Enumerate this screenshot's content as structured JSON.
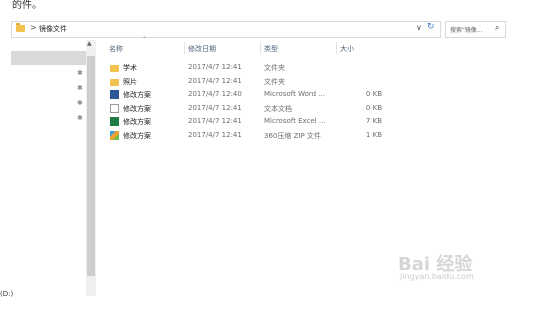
{
  "top_text": "的件。",
  "address": {
    "path": "镜像文件",
    "chevron": ">",
    "dropdown": "∨",
    "refresh": "↻"
  },
  "search": {
    "placeholder": "搜索\"镜像...",
    "icon": "⌕"
  },
  "columns": {
    "name": "名称",
    "date": "修改日期",
    "type": "类型",
    "size": "大小"
  },
  "files": [
    {
      "name": "学术",
      "date": "2017/4/7 12:41",
      "type": "文件夹",
      "size": "",
      "icon": "folder"
    },
    {
      "name": "照片",
      "date": "2017/4/7 12:41",
      "type": "文件夹",
      "size": "",
      "icon": "folder"
    },
    {
      "name": "修改方案",
      "date": "2017/4/7 12:40",
      "type": "Microsoft Word ...",
      "size": "0 KB",
      "icon": "word"
    },
    {
      "name": "修改方案",
      "date": "2017/4/7 12:41",
      "type": "文本文档",
      "size": "0 KB",
      "icon": "text"
    },
    {
      "name": "修改方案",
      "date": "2017/4/7 12:41",
      "type": "Microsoft Excel ...",
      "size": "7 KB",
      "icon": "excel"
    },
    {
      "name": "修改方案",
      "date": "2017/4/7 12:41",
      "type": "360压缩 ZIP 文件",
      "size": "1 KB",
      "icon": "zip"
    }
  ],
  "nav": {
    "bottom_label": "(D:)",
    "pin_glyph": "✱"
  },
  "watermark": {
    "main": "Bai 经验",
    "sub": "jingyan.baidu.com"
  }
}
